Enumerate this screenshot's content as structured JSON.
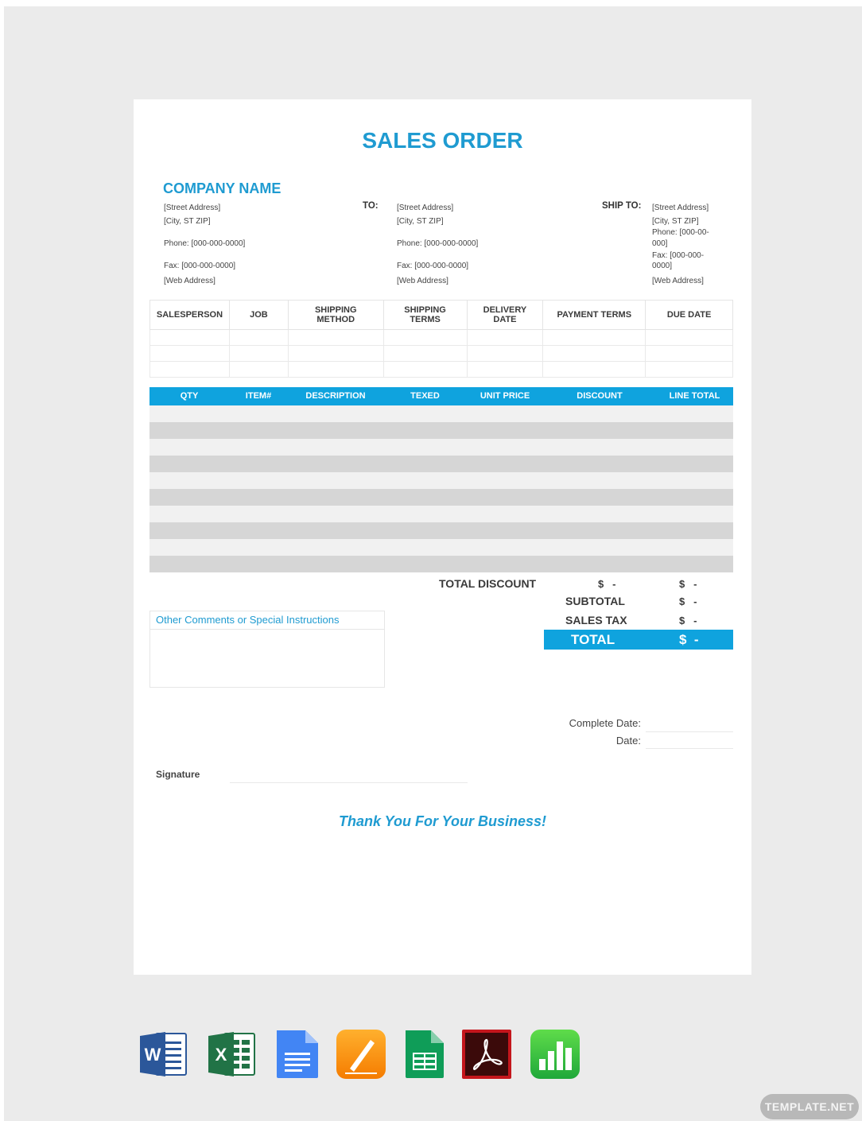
{
  "title": "SALES ORDER",
  "company": {
    "name": "COMPANY NAME",
    "street": "[Street Address]",
    "city": "[City, ST  ZIP]",
    "phone": "Phone: [000-000-0000]",
    "fax": "Fax: [000-000-0000]",
    "web": "[Web Address]"
  },
  "to": {
    "label": "TO:",
    "street": "[Street Address]",
    "city": "[City, ST  ZIP]",
    "phone": "Phone: [000-000-0000]",
    "fax": "Fax: [000-000-0000]",
    "web": "[Web Address]"
  },
  "ship_to": {
    "label": "SHIP TO:",
    "street": "[Street Address]",
    "city": "[City, ST  ZIP]",
    "phone_1": "Phone: [000-00-",
    "phone_2": "000]",
    "fax_1": "Fax: [000-000-",
    "fax_2": "0000]",
    "web": "[Web Address]"
  },
  "order_info_headers": [
    "SALESPERSON",
    "JOB",
    "SHIPPING\nMETHOD",
    "SHIPPING\nTERMS",
    "DELIVERY\nDATE",
    "PAYMENT TERMS",
    "DUE DATE"
  ],
  "item_headers": [
    "QTY",
    "ITEM#",
    "DESCRIPTION",
    "TEXED",
    "UNIT PRICE",
    "DISCOUNT",
    "LINE TOTAL"
  ],
  "totals": {
    "total_discount_label": "TOTAL DISCOUNT",
    "total_discount_value": "$   -",
    "total_discount_line": "$   -",
    "subtotal_label": "SUBTOTAL",
    "subtotal_value": "$   -",
    "sales_tax_label": "SALES TAX",
    "sales_tax_value": "$   -",
    "total_label": "TOTAL",
    "total_value": "$  -"
  },
  "comments_label": "Other Comments or Special Instructions",
  "complete_date_label": "Complete Date:",
  "date_label": "Date:",
  "signature_label": "Signature",
  "thanks": "Thank You For Your Business!",
  "app_icons": [
    "word-icon",
    "excel-icon",
    "google-docs-icon",
    "pages-icon",
    "google-sheets-icon",
    "pdf-icon",
    "numbers-icon"
  ],
  "badge": "TEMPLATE.NET",
  "colors": {
    "accent": "#0fa3de",
    "heading": "#1f9bd1",
    "stripe": "#d8d8d8"
  }
}
